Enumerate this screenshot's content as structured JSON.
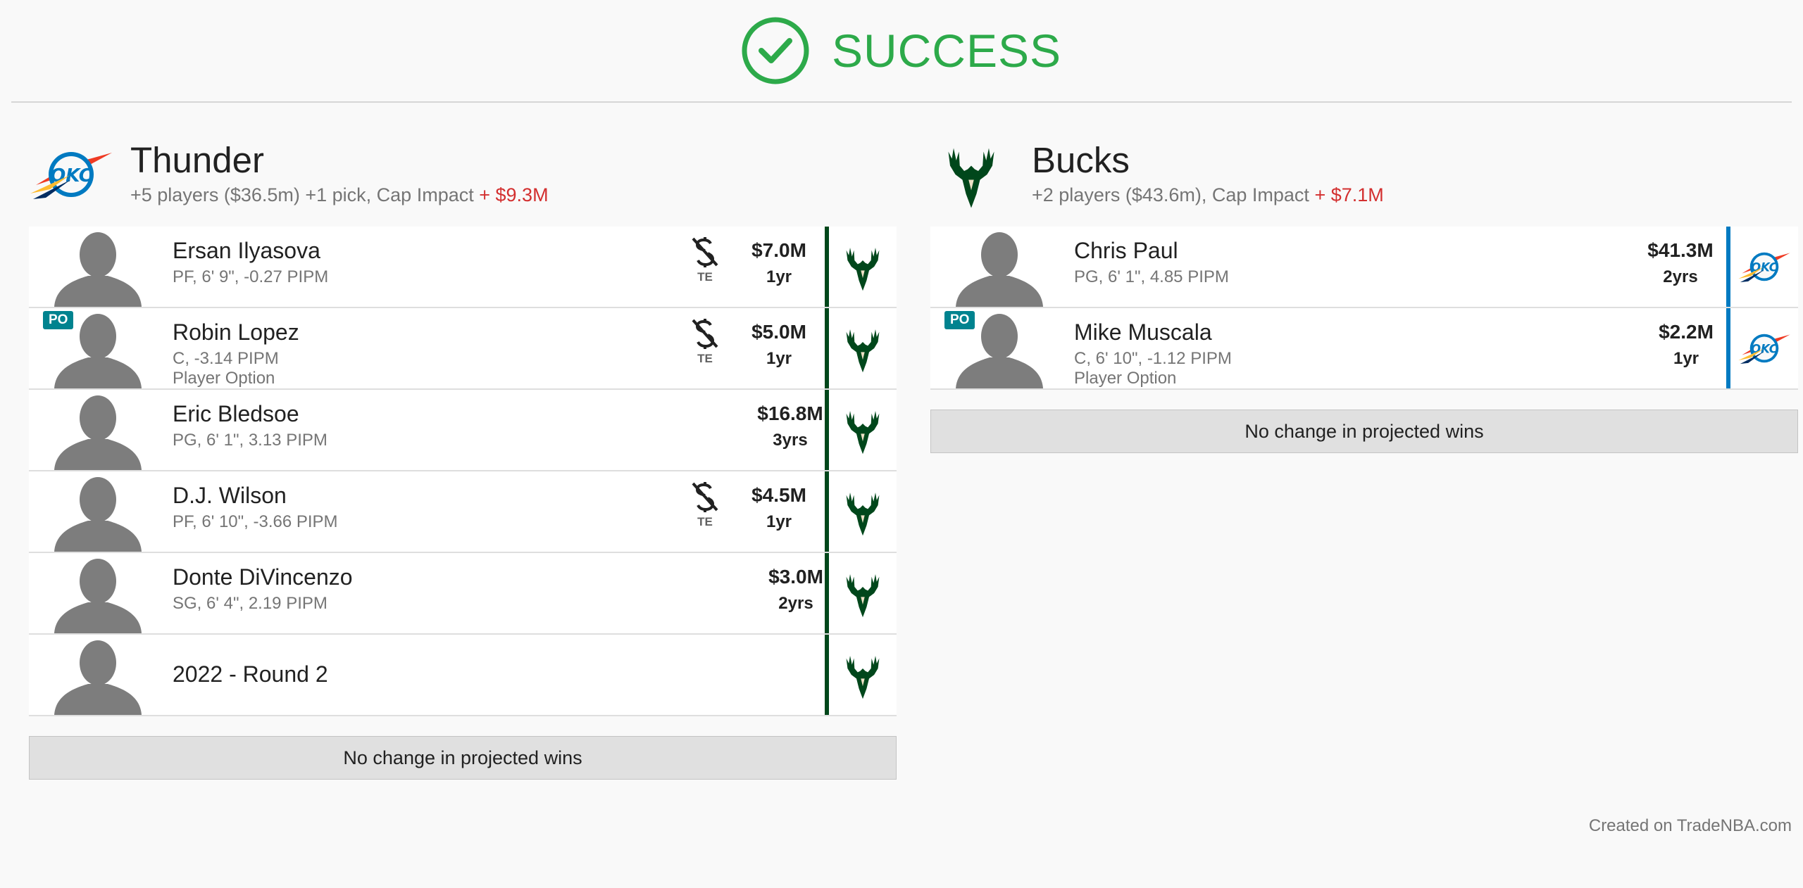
{
  "status": {
    "text": "SUCCESS",
    "icon": "check-circle-icon",
    "color": "#2daa4a"
  },
  "teams": [
    {
      "name": "Thunder",
      "logo": "thunder-logo",
      "summary": "+5 players ($36.5m) +1 pick, Cap Impact",
      "cap_impact": "+ $9.3M",
      "accent": "#00471b",
      "assets": [
        {
          "name": "Ersan Ilyasova",
          "info": "PF, 6' 9\", -0.27 PIPM",
          "salary": "$7.0M",
          "years": "1yr",
          "te": "TE",
          "dest": "bucks-logo"
        },
        {
          "name": "Robin Lopez",
          "info": "C, -3.14 PIPM",
          "option": "Player Option",
          "badge": "PO",
          "salary": "$5.0M",
          "years": "1yr",
          "te": "TE",
          "dest": "bucks-logo"
        },
        {
          "name": "Eric Bledsoe",
          "info": "PG, 6' 1\", 3.13 PIPM",
          "salary": "$16.8M",
          "years": "3yrs",
          "dest": "bucks-logo"
        },
        {
          "name": "D.J. Wilson",
          "info": "PF, 6' 10\", -3.66 PIPM",
          "salary": "$4.5M",
          "years": "1yr",
          "te": "TE",
          "dest": "bucks-logo"
        },
        {
          "name": "Donte DiVincenzo",
          "info": "SG, 6' 4\", 2.19 PIPM",
          "salary": "$3.0M",
          "years": "2yrs",
          "dest": "bucks-logo"
        },
        {
          "name": "2022 - Round 2",
          "dest": "bucks-logo"
        }
      ],
      "wins_text": "No change in projected wins"
    },
    {
      "name": "Bucks",
      "logo": "bucks-logo",
      "summary": "+2 players ($43.6m), Cap Impact",
      "cap_impact": "+ $7.1M",
      "accent": "#007ac1",
      "assets": [
        {
          "name": "Chris Paul",
          "info": "PG, 6' 1\", 4.85 PIPM",
          "salary": "$41.3M",
          "years": "2yrs",
          "dest": "thunder-logo"
        },
        {
          "name": "Mike Muscala",
          "info": "C, 6' 10\", -1.12 PIPM",
          "option": "Player Option",
          "badge": "PO",
          "salary": "$2.2M",
          "years": "1yr",
          "dest": "thunder-logo"
        }
      ],
      "wins_text": "No change in projected wins"
    }
  ],
  "footer": "Created on TradeNBA.com"
}
